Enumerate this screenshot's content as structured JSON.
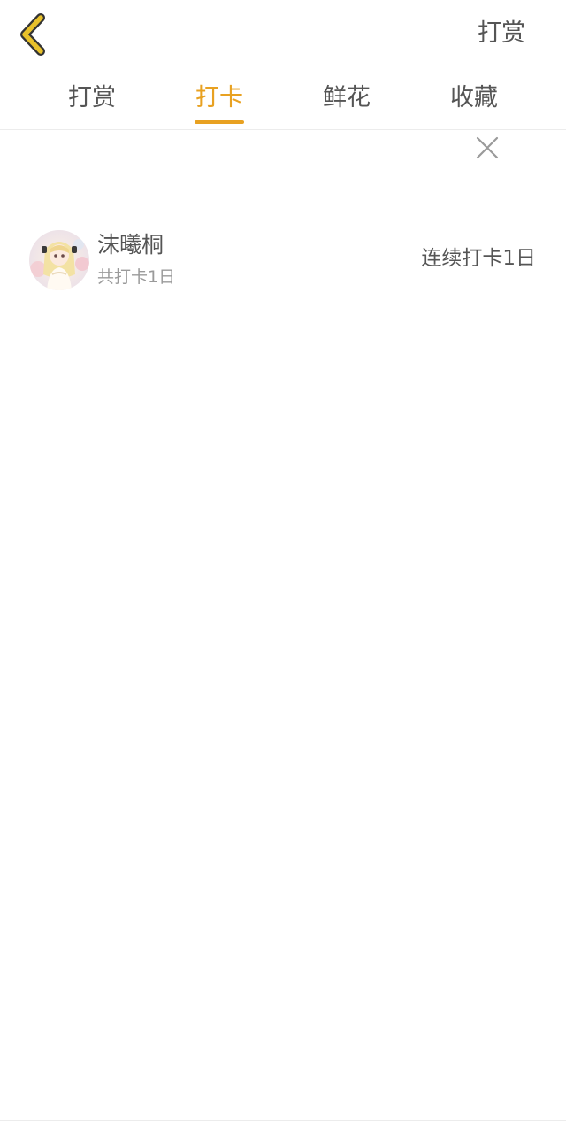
{
  "header": {
    "back_icon": "chevron-left-icon",
    "back_icon_color": "#e8c12a",
    "action_label": "打赏"
  },
  "tabs": [
    {
      "label": "打赏",
      "active": false
    },
    {
      "label": "打卡",
      "active": true
    },
    {
      "label": "鲜花",
      "active": false
    },
    {
      "label": "收藏",
      "active": false
    }
  ],
  "accent_color": "#e8a121",
  "close_icon": "close-icon",
  "list": [
    {
      "avatar_icon": "user-avatar",
      "name": "沫曦桐",
      "total": "共打卡1日",
      "streak": "连续打卡1日"
    }
  ]
}
